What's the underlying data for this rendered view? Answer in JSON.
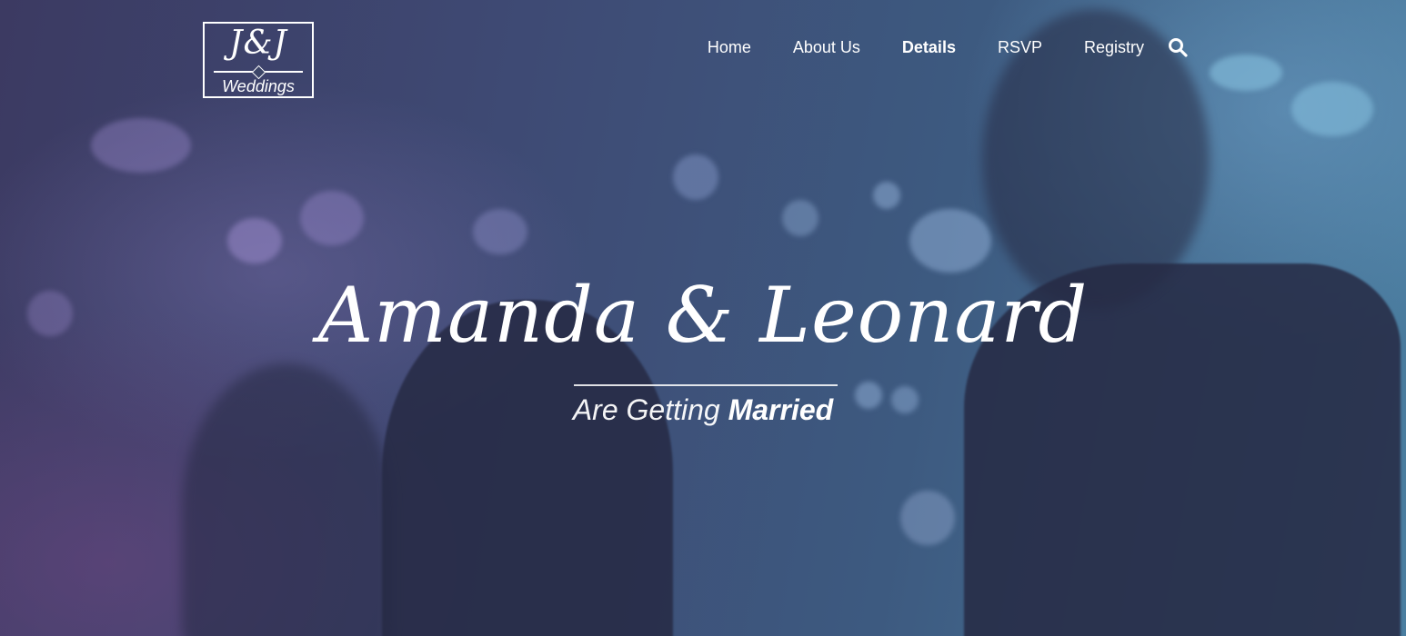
{
  "brand": {
    "monogram": "J&J",
    "subtitle": "Weddings"
  },
  "nav": {
    "items": [
      {
        "label": "Home",
        "active": false
      },
      {
        "label": "About Us",
        "active": false
      },
      {
        "label": "Details",
        "active": true
      },
      {
        "label": "RSVP",
        "active": false
      },
      {
        "label": "Registry",
        "active": false
      }
    ],
    "search_icon": "search-icon"
  },
  "hero": {
    "title": "Amanda & Leonard",
    "tagline_light": "Are Getting",
    "tagline_bold": "Married"
  },
  "colors": {
    "text": "#ffffff",
    "overlay_left": "#3c3a62",
    "overlay_right": "#4a7ea0"
  }
}
